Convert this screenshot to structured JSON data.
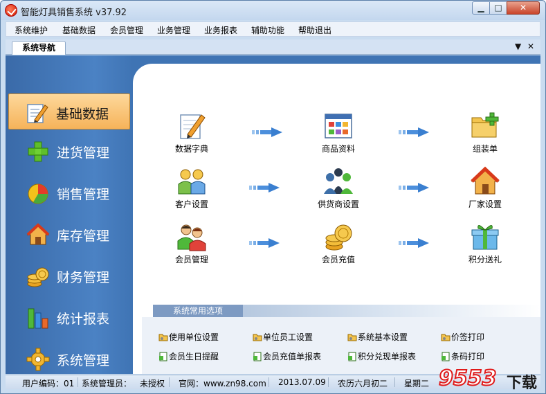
{
  "window": {
    "title": "智能灯具销售系统 v37.92"
  },
  "menu": [
    "系统维护",
    "基础数据",
    "会员管理",
    "业务管理",
    "业务报表",
    "辅助功能",
    "帮助退出"
  ],
  "tab": {
    "label": "系统导航",
    "dropdown_icon": "▼",
    "close_icon": "✕"
  },
  "sidebar": {
    "items": [
      {
        "label": "基础数据",
        "icon": "edit-icon",
        "active": true
      },
      {
        "label": "进货管理",
        "icon": "plus-icon"
      },
      {
        "label": "销售管理",
        "icon": "pie-chart-icon"
      },
      {
        "label": "库存管理",
        "icon": "house-icon"
      },
      {
        "label": "财务管理",
        "icon": "coins-icon"
      },
      {
        "label": "统计报表",
        "icon": "bar-chart-icon"
      },
      {
        "label": "系统管理",
        "icon": "gear-icon"
      }
    ]
  },
  "nodes": [
    {
      "label": "数据字典",
      "icon": "notepad-pencil-icon"
    },
    {
      "label": "商品资料",
      "icon": "grid-window-icon"
    },
    {
      "label": "组装单",
      "icon": "folder-plus-icon"
    },
    {
      "label": "客户设置",
      "icon": "two-users-icon"
    },
    {
      "label": "供货商设置",
      "icon": "people-group-icon"
    },
    {
      "label": "厂家设置",
      "icon": "house-icon"
    },
    {
      "label": "会员管理",
      "icon": "member-users-icon"
    },
    {
      "label": "会员充值",
      "icon": "coins-icon"
    },
    {
      "label": "积分送礼",
      "icon": "gift-box-icon"
    }
  ],
  "options": {
    "header": "系统常用选项",
    "items": [
      {
        "label": "使用单位设置",
        "icon": "folder-settings-icon"
      },
      {
        "label": "单位员工设置",
        "icon": "folder-settings-icon"
      },
      {
        "label": "系统基本设置",
        "icon": "folder-settings-icon"
      },
      {
        "label": "价签打印",
        "icon": "folder-settings-icon"
      },
      {
        "label": "会员生日提醒",
        "icon": "green-file-icon"
      },
      {
        "label": "会员充值单报表",
        "icon": "green-file-icon"
      },
      {
        "label": "积分兑现单报表",
        "icon": "green-file-icon"
      },
      {
        "label": "条码打印",
        "icon": "green-file-icon"
      }
    ]
  },
  "status": {
    "user_code": "用户编码：01",
    "user_name": "系统管理员：",
    "auth": "未授权",
    "website": "官网：www.zn98.com",
    "date": "2013.07.09",
    "lunar": "农历六月初二",
    "weekday": "星期二"
  },
  "watermark": {
    "number": "9553",
    "suffix": "下载"
  },
  "colors": {
    "sidebar_bg": "#3f74b4",
    "active_item": "#f6b35a",
    "panel_bg": "#ffffff"
  }
}
